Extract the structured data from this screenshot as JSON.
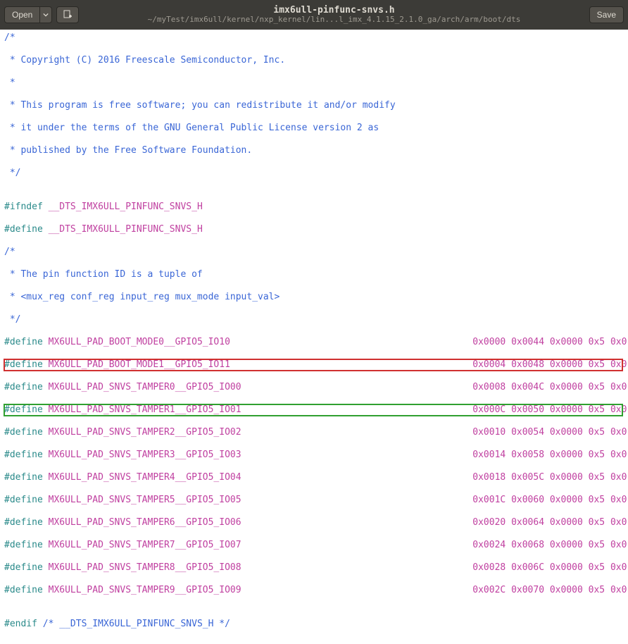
{
  "header": {
    "open_label": "Open",
    "save_label": "Save",
    "title": "imx6ull-pinfunc-snvs.h",
    "subtitle": "~/myTest/imx6ull/kernel/nxp_kernel/lin...l_imx_4.1.15_2.1.0_ga/arch/arm/boot/dts"
  },
  "code": {
    "comment_open": "/*",
    "copyright": " * Copyright (C) 2016 Freescale Semiconductor, Inc.",
    "blank_star": " *",
    "l1": " * This program is free software; you can redistribute it and/or modify",
    "l2": " * it under the terms of the GNU General Public License version 2 as",
    "l3": " * published by the Free Software Foundation.",
    "comment_close": " */",
    "ifndef_kw": "#ifndef",
    "define_kw": "#define",
    "guard": " __DTS_IMX6ULL_PINFUNC_SNVS_H",
    "pin_comment_1": " * The pin function ID is a tuple of",
    "pin_comment_2": " * <mux_reg conf_reg input_reg mux_mode input_val>",
    "defines": [
      {
        "name": "MX6ULL_PAD_BOOT_MODE0__GPIO5_IO10",
        "vals": "0x0000 0x0044 0x0000 0x5 0x0",
        "hl": ""
      },
      {
        "name": "MX6ULL_PAD_BOOT_MODE1__GPIO5_IO11",
        "vals": "0x0004 0x0048 0x0000 0x5 0x0",
        "hl": "red"
      },
      {
        "name": "MX6ULL_PAD_SNVS_TAMPER0__GPIO5_IO00",
        "vals": "0x0008 0x004C 0x0000 0x5 0x0",
        "hl": ""
      },
      {
        "name": "MX6ULL_PAD_SNVS_TAMPER1__GPIO5_IO01",
        "vals": "0x000C 0x0050 0x0000 0x5 0x0",
        "hl": "green"
      },
      {
        "name": "MX6ULL_PAD_SNVS_TAMPER2__GPIO5_IO02",
        "vals": "0x0010 0x0054 0x0000 0x5 0x0",
        "hl": ""
      },
      {
        "name": "MX6ULL_PAD_SNVS_TAMPER3__GPIO5_IO03",
        "vals": "0x0014 0x0058 0x0000 0x5 0x0",
        "hl": ""
      },
      {
        "name": "MX6ULL_PAD_SNVS_TAMPER4__GPIO5_IO04",
        "vals": "0x0018 0x005C 0x0000 0x5 0x0",
        "hl": ""
      },
      {
        "name": "MX6ULL_PAD_SNVS_TAMPER5__GPIO5_IO05",
        "vals": "0x001C 0x0060 0x0000 0x5 0x0",
        "hl": ""
      },
      {
        "name": "MX6ULL_PAD_SNVS_TAMPER6__GPIO5_IO06",
        "vals": "0x0020 0x0064 0x0000 0x5 0x0",
        "hl": ""
      },
      {
        "name": "MX6ULL_PAD_SNVS_TAMPER7__GPIO5_IO07",
        "vals": "0x0024 0x0068 0x0000 0x5 0x0",
        "hl": ""
      },
      {
        "name": "MX6ULL_PAD_SNVS_TAMPER8__GPIO5_IO08",
        "vals": "0x0028 0x006C 0x0000 0x5 0x0",
        "hl": ""
      },
      {
        "name": "MX6ULL_PAD_SNVS_TAMPER9__GPIO5_IO09",
        "vals": "0x002C 0x0070 0x0000 0x5 0x0",
        "hl": ""
      }
    ],
    "endif_kw": "#endif",
    "endif_comment": " /* __DTS_IMX6ULL_PINFUNC_SNVS_H */"
  }
}
